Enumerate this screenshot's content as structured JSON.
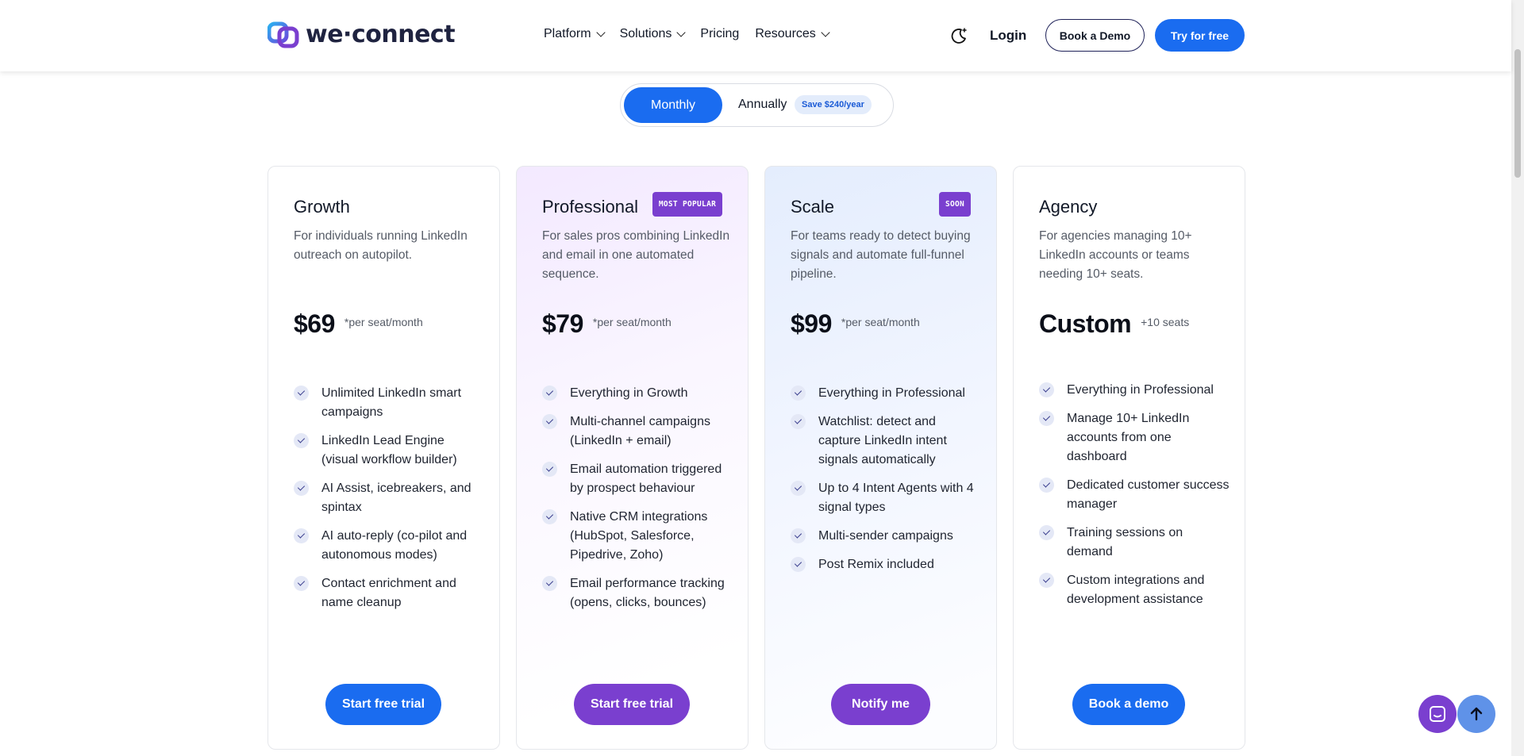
{
  "brand": {
    "name": "we·connect",
    "primary_color": "#1a6cf0",
    "accent_purple": "#7a3fcf"
  },
  "nav": {
    "items": [
      {
        "label": "Platform",
        "has_dropdown": true
      },
      {
        "label": "Solutions",
        "has_dropdown": true
      },
      {
        "label": "Pricing",
        "has_dropdown": false
      },
      {
        "label": "Resources",
        "has_dropdown": true
      }
    ],
    "theme_icon": "moon-sparkle-icon",
    "login": "Login",
    "book_demo": "Book a Demo",
    "try_free": "Try for free"
  },
  "billing_toggle": {
    "monthly": "Monthly",
    "annually": "Annually",
    "save_badge": "Save $240/year",
    "selected": "Monthly"
  },
  "plans": [
    {
      "name": "Growth",
      "badge": "",
      "description": "For individuals running LinkedIn outreach on autopilot.",
      "price": "$69",
      "price_note": "*per seat/month",
      "features": [
        "Unlimited LinkedIn smart campaigns",
        "LinkedIn Lead Engine (visual workflow builder)",
        "AI Assist, icebreakers, and spintax",
        "AI auto-reply (co-pilot and autonomous modes)",
        "Contact enrichment and name cleanup"
      ],
      "cta": "Start free trial",
      "cta_color": "#1a6cf0"
    },
    {
      "name": "Professional",
      "badge": "MOST POPULAR",
      "description": "For sales pros combining LinkedIn and email in one automated sequence.",
      "price": "$79",
      "price_note": "*per seat/month",
      "features": [
        "Everything in Growth",
        "Multi-channel campaigns (LinkedIn + email)",
        "Email automation triggered by prospect behaviour",
        "Native CRM integrations (HubSpot, Salesforce, Pipedrive, Zoho)",
        "Email performance tracking (opens, clicks, bounces)"
      ],
      "cta": "Start free trial",
      "cta_color": "#7a3fcf"
    },
    {
      "name": "Scale",
      "badge": "SOON",
      "description": "For teams ready to detect buying signals and automate full-funnel pipeline.",
      "price": "$99",
      "price_note": "*per seat/month",
      "features": [
        "Everything in Professional",
        "Watchlist: detect and capture LinkedIn intent signals automatically",
        "Up to 4 Intent Agents with 4 signal types",
        "Multi-sender campaigns",
        "Post Remix included"
      ],
      "cta": "Notify me",
      "cta_color": "#7a3fcf"
    },
    {
      "name": "Agency",
      "badge": "",
      "description": "For agencies managing 10+ LinkedIn accounts or teams needing 10+ seats.",
      "price": "Custom",
      "price_note": "+10 seats",
      "features": [
        "Everything in Professional",
        "Manage 10+ LinkedIn accounts from one dashboard",
        "Dedicated customer success manager",
        "Training sessions on demand",
        "Custom integrations and development assistance"
      ],
      "cta": "Book a demo",
      "cta_color": "#1a6cf0"
    }
  ],
  "floating": {
    "chat_icon": "chat-icon",
    "scroll_top_icon": "arrow-up-icon"
  }
}
